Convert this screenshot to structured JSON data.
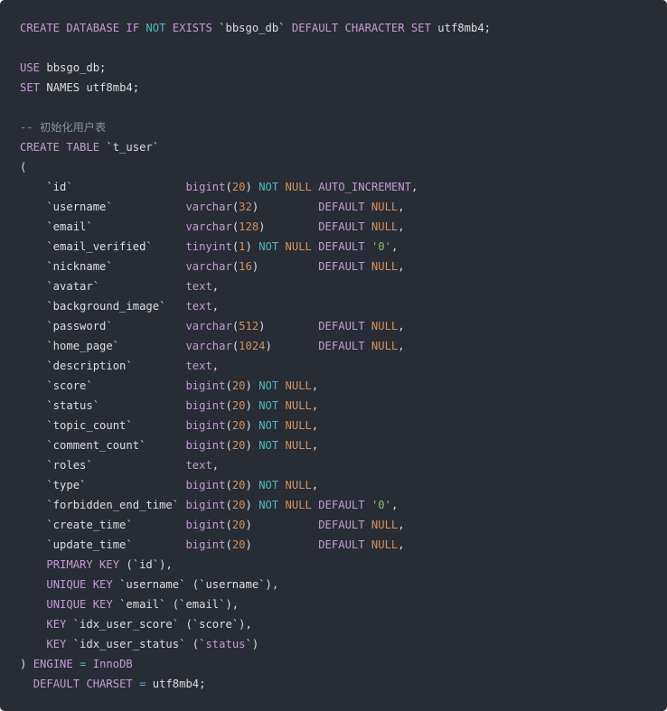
{
  "colors": {
    "background": "#282c34",
    "keyword": "#c49bd8",
    "operator": "#4fb8c4",
    "literal": "#d3925e",
    "string": "#8cbc79",
    "comment": "#8a919d",
    "plain": "#dcdfe4"
  },
  "code": {
    "language": "sql",
    "lines": [
      [
        [
          "k",
          "CREATE DATABASE IF "
        ],
        [
          "c",
          "NOT"
        ],
        [
          "k",
          " EXISTS "
        ],
        [
          "t",
          "`bbsgo_db` "
        ],
        [
          "k",
          "DEFAULT CHARACTER SET "
        ],
        [
          "t",
          "utf8mb4;"
        ]
      ],
      [],
      [
        [
          "k",
          "USE "
        ],
        [
          "t",
          "bbsgo_db;"
        ]
      ],
      [
        [
          "k",
          "SET "
        ],
        [
          "t",
          "NAMES utf8mb4;"
        ]
      ],
      [],
      [
        [
          "m",
          "-- 初始化用户表"
        ]
      ],
      [
        [
          "k",
          "CREATE TABLE "
        ],
        [
          "t",
          "`t_user`"
        ]
      ],
      [
        [
          "t",
          "("
        ]
      ],
      [
        [
          "t",
          "    `id`                 "
        ],
        [
          "k",
          "bigint"
        ],
        [
          "t",
          "("
        ],
        [
          "o",
          "20"
        ],
        [
          "t",
          ") "
        ],
        [
          "c",
          "NOT"
        ],
        [
          "t",
          " "
        ],
        [
          "o",
          "NULL"
        ],
        [
          "t",
          " "
        ],
        [
          "k",
          "AUTO_INCREMENT"
        ],
        [
          "t",
          ","
        ]
      ],
      [
        [
          "t",
          "    `username`           "
        ],
        [
          "k",
          "varchar"
        ],
        [
          "t",
          "("
        ],
        [
          "o",
          "32"
        ],
        [
          "t",
          ")         "
        ],
        [
          "k",
          "DEFAULT "
        ],
        [
          "o",
          "NULL"
        ],
        [
          "t",
          ","
        ]
      ],
      [
        [
          "t",
          "    `email`              "
        ],
        [
          "k",
          "varchar"
        ],
        [
          "t",
          "("
        ],
        [
          "o",
          "128"
        ],
        [
          "t",
          ")        "
        ],
        [
          "k",
          "DEFAULT "
        ],
        [
          "o",
          "NULL"
        ],
        [
          "t",
          ","
        ]
      ],
      [
        [
          "t",
          "    `email_verified`     "
        ],
        [
          "k",
          "tinyint"
        ],
        [
          "t",
          "("
        ],
        [
          "o",
          "1"
        ],
        [
          "t",
          ") "
        ],
        [
          "c",
          "NOT"
        ],
        [
          "t",
          " "
        ],
        [
          "o",
          "NULL"
        ],
        [
          "t",
          " "
        ],
        [
          "k",
          "DEFAULT "
        ],
        [
          "s",
          "'0'"
        ],
        [
          "t",
          ","
        ]
      ],
      [
        [
          "t",
          "    `nickname`           "
        ],
        [
          "k",
          "varchar"
        ],
        [
          "t",
          "("
        ],
        [
          "o",
          "16"
        ],
        [
          "t",
          ")         "
        ],
        [
          "k",
          "DEFAULT "
        ],
        [
          "o",
          "NULL"
        ],
        [
          "t",
          ","
        ]
      ],
      [
        [
          "t",
          "    `avatar`             "
        ],
        [
          "k",
          "text"
        ],
        [
          "t",
          ","
        ]
      ],
      [
        [
          "t",
          "    `background_image`   "
        ],
        [
          "k",
          "text"
        ],
        [
          "t",
          ","
        ]
      ],
      [
        [
          "t",
          "    `password`           "
        ],
        [
          "k",
          "varchar"
        ],
        [
          "t",
          "("
        ],
        [
          "o",
          "512"
        ],
        [
          "t",
          ")        "
        ],
        [
          "k",
          "DEFAULT "
        ],
        [
          "o",
          "NULL"
        ],
        [
          "t",
          ","
        ]
      ],
      [
        [
          "t",
          "    `home_page`          "
        ],
        [
          "k",
          "varchar"
        ],
        [
          "t",
          "("
        ],
        [
          "o",
          "1024"
        ],
        [
          "t",
          ")       "
        ],
        [
          "k",
          "DEFAULT "
        ],
        [
          "o",
          "NULL"
        ],
        [
          "t",
          ","
        ]
      ],
      [
        [
          "t",
          "    `description`        "
        ],
        [
          "k",
          "text"
        ],
        [
          "t",
          ","
        ]
      ],
      [
        [
          "t",
          "    `score`              "
        ],
        [
          "k",
          "bigint"
        ],
        [
          "t",
          "("
        ],
        [
          "o",
          "20"
        ],
        [
          "t",
          ") "
        ],
        [
          "c",
          "NOT"
        ],
        [
          "t",
          " "
        ],
        [
          "o",
          "NULL"
        ],
        [
          "t",
          ","
        ]
      ],
      [
        [
          "t",
          "    `status`             "
        ],
        [
          "k",
          "bigint"
        ],
        [
          "t",
          "("
        ],
        [
          "o",
          "20"
        ],
        [
          "t",
          ") "
        ],
        [
          "c",
          "NOT"
        ],
        [
          "t",
          " "
        ],
        [
          "o",
          "NULL"
        ],
        [
          "t",
          ","
        ]
      ],
      [
        [
          "t",
          "    `topic_count`        "
        ],
        [
          "k",
          "bigint"
        ],
        [
          "t",
          "("
        ],
        [
          "o",
          "20"
        ],
        [
          "t",
          ") "
        ],
        [
          "c",
          "NOT"
        ],
        [
          "t",
          " "
        ],
        [
          "o",
          "NULL"
        ],
        [
          "t",
          ","
        ]
      ],
      [
        [
          "t",
          "    `comment_count`      "
        ],
        [
          "k",
          "bigint"
        ],
        [
          "t",
          "("
        ],
        [
          "o",
          "20"
        ],
        [
          "t",
          ") "
        ],
        [
          "c",
          "NOT"
        ],
        [
          "t",
          " "
        ],
        [
          "o",
          "NULL"
        ],
        [
          "t",
          ","
        ]
      ],
      [
        [
          "t",
          "    `roles`              "
        ],
        [
          "k",
          "text"
        ],
        [
          "t",
          ","
        ]
      ],
      [
        [
          "t",
          "    `type`               "
        ],
        [
          "k",
          "bigint"
        ],
        [
          "t",
          "("
        ],
        [
          "o",
          "20"
        ],
        [
          "t",
          ") "
        ],
        [
          "c",
          "NOT"
        ],
        [
          "t",
          " "
        ],
        [
          "o",
          "NULL"
        ],
        [
          "t",
          ","
        ]
      ],
      [
        [
          "t",
          "    `forbidden_end_time` "
        ],
        [
          "k",
          "bigint"
        ],
        [
          "t",
          "("
        ],
        [
          "o",
          "20"
        ],
        [
          "t",
          ") "
        ],
        [
          "c",
          "NOT"
        ],
        [
          "t",
          " "
        ],
        [
          "o",
          "NULL"
        ],
        [
          "t",
          " "
        ],
        [
          "k",
          "DEFAULT "
        ],
        [
          "s",
          "'0'"
        ],
        [
          "t",
          ","
        ]
      ],
      [
        [
          "t",
          "    `create_time`        "
        ],
        [
          "k",
          "bigint"
        ],
        [
          "t",
          "("
        ],
        [
          "o",
          "20"
        ],
        [
          "t",
          ")          "
        ],
        [
          "k",
          "DEFAULT "
        ],
        [
          "o",
          "NULL"
        ],
        [
          "t",
          ","
        ]
      ],
      [
        [
          "t",
          "    `update_time`        "
        ],
        [
          "k",
          "bigint"
        ],
        [
          "t",
          "("
        ],
        [
          "o",
          "20"
        ],
        [
          "t",
          ")          "
        ],
        [
          "k",
          "DEFAULT "
        ],
        [
          "o",
          "NULL"
        ],
        [
          "t",
          ","
        ]
      ],
      [
        [
          "t",
          "    "
        ],
        [
          "k",
          "PRIMARY KEY"
        ],
        [
          "t",
          " (`id`),"
        ]
      ],
      [
        [
          "t",
          "    "
        ],
        [
          "k",
          "UNIQUE KEY"
        ],
        [
          "t",
          " `username` (`username`),"
        ]
      ],
      [
        [
          "t",
          "    "
        ],
        [
          "k",
          "UNIQUE KEY"
        ],
        [
          "t",
          " `email` (`email`),"
        ]
      ],
      [
        [
          "t",
          "    "
        ],
        [
          "k",
          "KEY"
        ],
        [
          "t",
          " `idx_user_score` (`score`),"
        ]
      ],
      [
        [
          "t",
          "    "
        ],
        [
          "k",
          "KEY"
        ],
        [
          "t",
          " `idx_user_status` (`"
        ],
        [
          "k",
          "status"
        ],
        [
          "t",
          "`)"
        ]
      ],
      [
        [
          "t",
          ") "
        ],
        [
          "k",
          "ENGINE"
        ],
        [
          "t",
          " "
        ],
        [
          "c",
          "="
        ],
        [
          "t",
          " "
        ],
        [
          "k",
          "InnoDB"
        ]
      ],
      [
        [
          "t",
          "  "
        ],
        [
          "k",
          "DEFAULT CHARSET"
        ],
        [
          "t",
          " "
        ],
        [
          "c",
          "="
        ],
        [
          "t",
          " utf8mb4;"
        ]
      ]
    ]
  }
}
